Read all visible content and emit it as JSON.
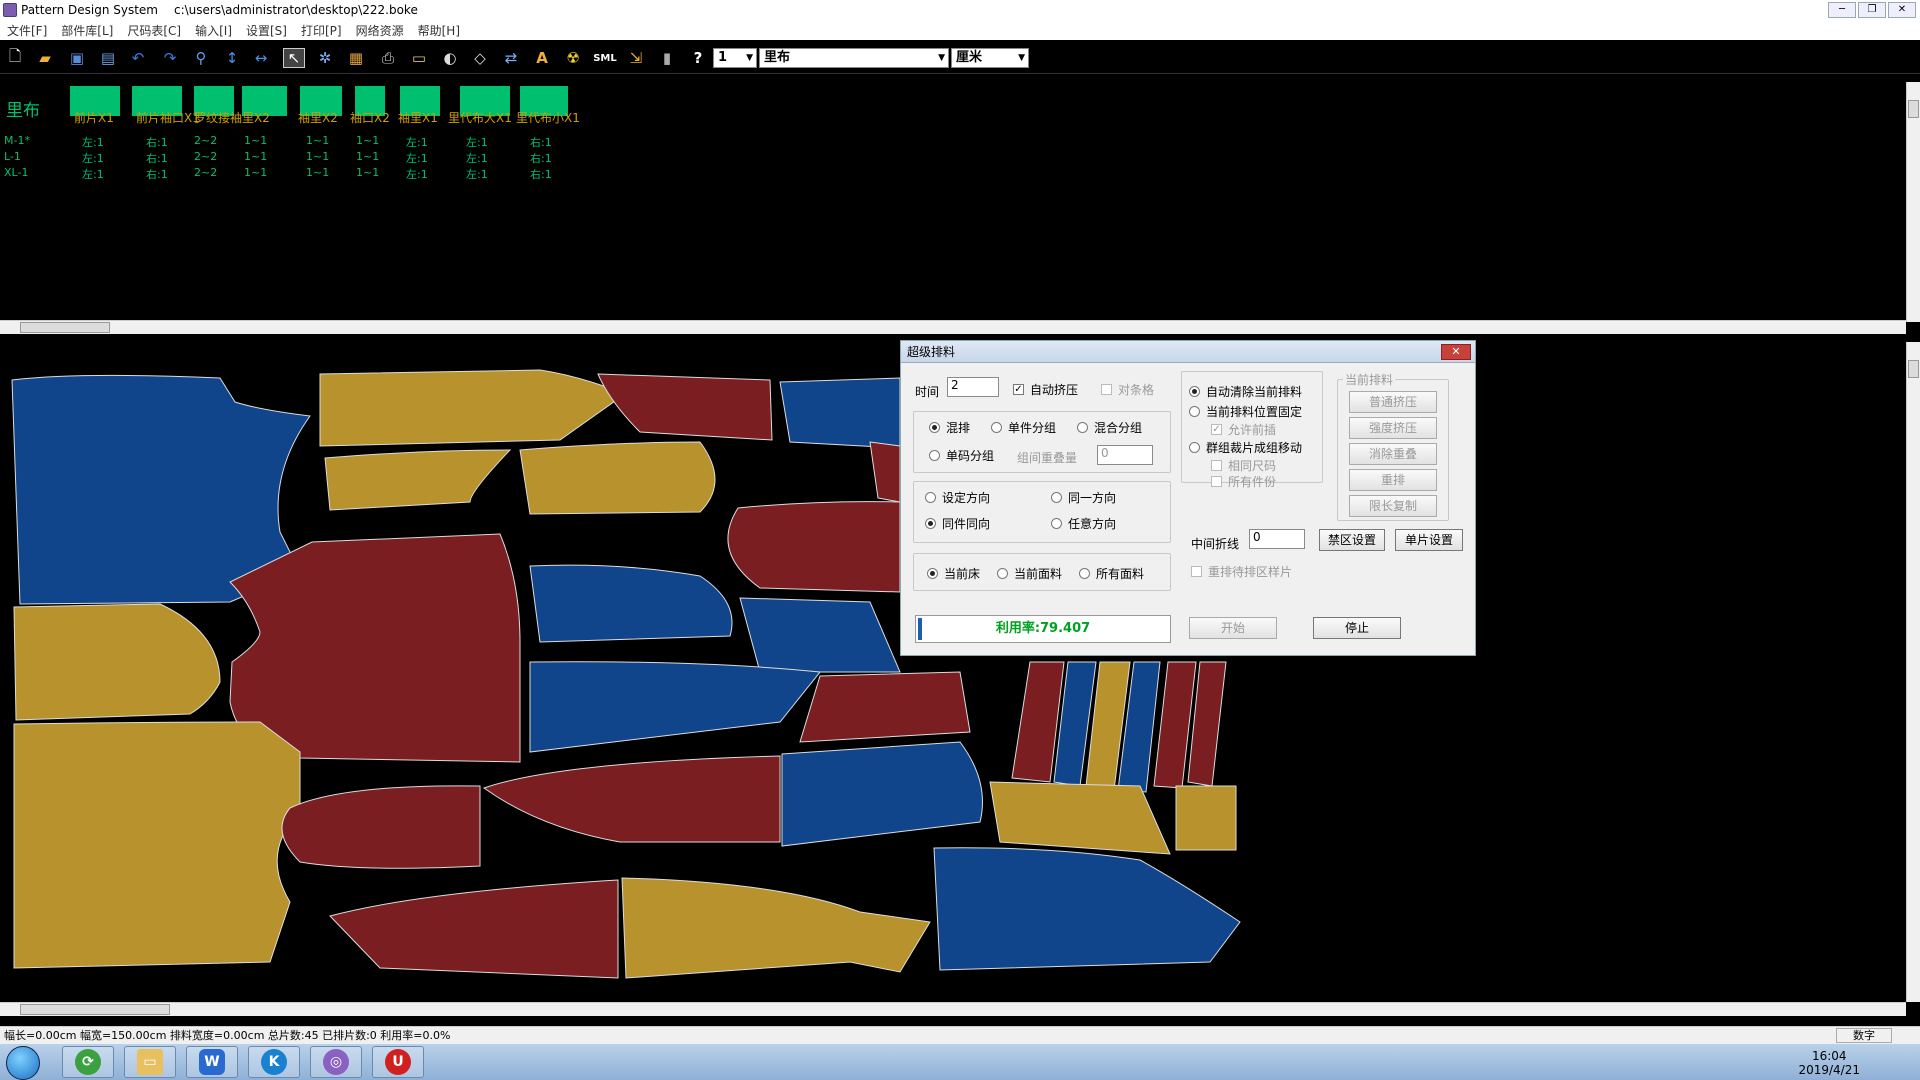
{
  "titlebar": {
    "app": "Pattern Design System",
    "path": "c:\\users\\administrator\\desktop\\222.boke"
  },
  "menu": [
    "文件[F]",
    "部件库[L]",
    "尺码表[C]",
    "输入[I]",
    "设置[S]",
    "打印[P]",
    "网络资源",
    "帮助[H]"
  ],
  "toolbar": {
    "icons": [
      "new-file-icon",
      "open-folder-icon",
      "save-icon",
      "save-as-icon",
      "undo-icon",
      "redo-icon",
      "zoom-icon",
      "vertical-move-icon",
      "horizontal-move-icon",
      "select-arrow-icon",
      "layout-wheel-icon",
      "pattern-icon",
      "print-icon",
      "plotter-icon",
      "rotate-icon",
      "flip-icon",
      "align-icon",
      "text-icon",
      "radiation-icon",
      "sml-icon",
      "export-icon",
      "bottle-icon",
      "help-icon"
    ],
    "sml_label": "SML",
    "text_label": "A",
    "help_label": "?",
    "bed_value": "1",
    "fabric_value": "里布",
    "unit_value": "厘米"
  },
  "fabric_label": "里布",
  "columns": [
    "前片X1",
    "前片袖口X1",
    "罗纹接袖里X2",
    "袖里X2",
    "袖口X2",
    "袖里X1",
    "里代布大X1",
    "里代布小X1"
  ],
  "rows": [
    {
      "size": "M-1*",
      "cells": [
        "左:1",
        "右:1",
        "2~2",
        "1~1",
        "1~1",
        "1~1",
        "左:1",
        "左:1",
        "右:1"
      ]
    },
    {
      "size": "L-1",
      "cells": [
        "左:1",
        "右:1",
        "2~2",
        "1~1",
        "1~1",
        "1~1",
        "左:1",
        "左:1",
        "右:1"
      ]
    },
    {
      "size": "XL-1",
      "cells": [
        "左:1",
        "右:1",
        "2~2",
        "1~1",
        "1~1",
        "1~1",
        "左:1",
        "左:1",
        "右:1"
      ]
    }
  ],
  "piece_colors": {
    "blue": "#10458c",
    "gold": "#b8922c",
    "red": "#7a1e22"
  },
  "dialog": {
    "title": "超级排料",
    "time_label": "时间",
    "time_value": "2",
    "auto_squeeze": "自动挤压",
    "stripes": "对条格",
    "g1": [
      "混排",
      "单件分组",
      "混合分组",
      "单码分组"
    ],
    "group_overlap": "组间重叠量",
    "group_overlap_value": "0",
    "g2": [
      "设定方向",
      "同一方向",
      "同件同向",
      "任意方向"
    ],
    "g3": [
      "当前床",
      "当前面料",
      "所有面料"
    ],
    "utilization": "利用率:79.407",
    "r1": "自动清除当前排料",
    "r2": "当前排料位置固定",
    "allow_front": "允许前插",
    "r3": "群组裁片成组移动",
    "same_size": "相同尺码",
    "all_pieces": "所有件份",
    "current_group": "当前排料",
    "btn_normal": "普通挤压",
    "btn_strong": "强度挤压",
    "btn_clear": "消除重叠",
    "btn_repack": "重排",
    "btn_limit": "限长复制",
    "midfold": "中间折线",
    "midfold_value": "0",
    "btn_forbid": "禁区设置",
    "btn_single": "单片设置",
    "repack_waiting": "重排待排区样片",
    "btn_start": "开始",
    "btn_stop": "停止"
  },
  "status": {
    "text": "幅长=0.00cm 幅宽=150.00cm 排料宽度=0.00cm 总片数:45 已排片数:0 利用率=0.0%",
    "mode": "数字"
  },
  "tray": {
    "time": "16:04",
    "date": "2019/4/21"
  }
}
